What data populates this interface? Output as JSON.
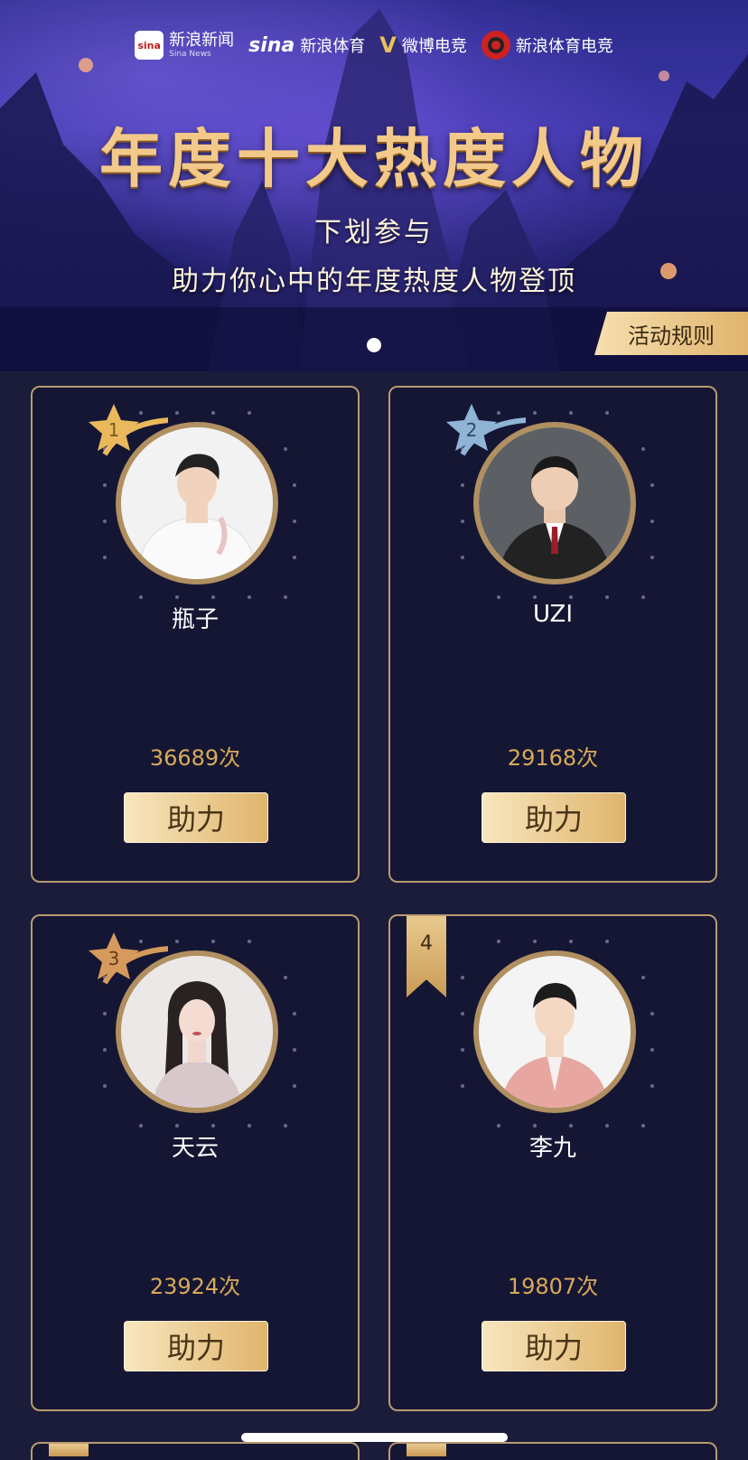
{
  "partners": [
    {
      "logo": "sina-news-logo",
      "name": "新浪新闻",
      "sub": "Sina News"
    },
    {
      "logo": "sina-sports-logo",
      "mark": "sina",
      "name": "新浪体育"
    },
    {
      "logo": "weibo-esports-logo",
      "mark": "V",
      "name": "微博电竞"
    },
    {
      "logo": "sina-sports-esports-logo",
      "name": "新浪体育电竞"
    }
  ],
  "sina_news_mark": "sina",
  "banner": {
    "title": "年度十大热度人物",
    "subtitle_line1": "下划参与",
    "subtitle_line2": "助力你心中的年度热度人物登顶"
  },
  "rules_button": "活动规则",
  "candidates": [
    {
      "rank": "1",
      "name": "瓶子",
      "count": "36689次",
      "button": "助力",
      "badge": "gold-star",
      "badge_color": "#e9b95c"
    },
    {
      "rank": "2",
      "name": "UZI",
      "count": "29168次",
      "button": "助力",
      "badge": "silver-star",
      "badge_color": "#8fb4d6"
    },
    {
      "rank": "3",
      "name": "天云",
      "count": "23924次",
      "button": "助力",
      "badge": "bronze-star",
      "badge_color": "#d59a5c"
    },
    {
      "rank": "4",
      "name": "李九",
      "count": "19807次",
      "button": "助力",
      "badge": "ribbon",
      "badge_color": "#dcb575"
    }
  ],
  "colors": {
    "background": "#1b1c3a",
    "card_border": "#b89a72",
    "accent_gold": "#d8aa5a"
  }
}
